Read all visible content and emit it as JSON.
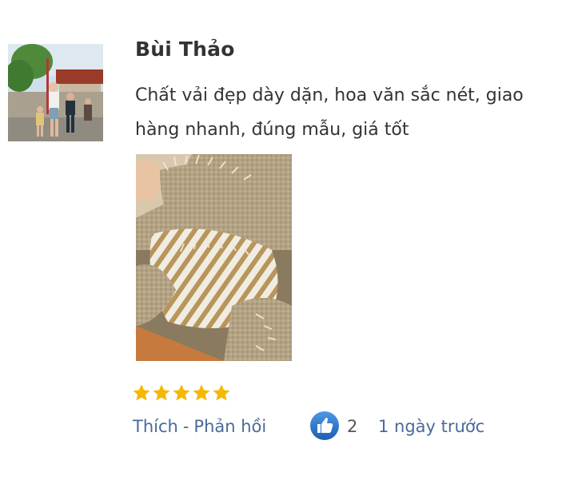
{
  "review": {
    "author": "Bùi Thảo",
    "comment": "Chất vải đẹp dày dặn, hoa văn sắc nét, giao hàng nhanh, đúng mẫu, giá tốt",
    "rating": 5,
    "rating_max": 5,
    "actions": {
      "like_label": "Thích",
      "separator": "-",
      "reply_label": "Phản hồi"
    },
    "like_count": "2",
    "time_ago": "1 ngày trước",
    "colors": {
      "star": "#f5b800",
      "link": "#4a6a9a",
      "like_badge": "#2a73c9"
    }
  }
}
